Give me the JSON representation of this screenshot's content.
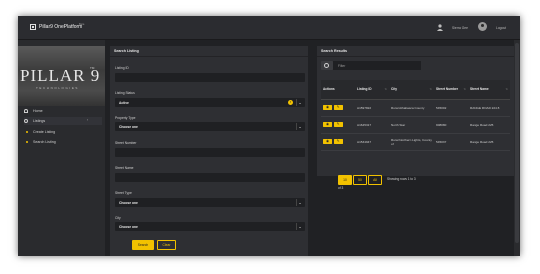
{
  "app": {
    "title": "Pillar9 OnePlatform",
    "badge": "Beta"
  },
  "user": {
    "name": "Sierra Gee",
    "logout": "Logout"
  },
  "brand": {
    "main": "PILLAR 9",
    "tm": "TM",
    "sub": "TECHNOLOGIES"
  },
  "sidebar": {
    "items": [
      {
        "label": "Home",
        "icon": "home-icon"
      },
      {
        "label": "Listings",
        "icon": "listings-icon",
        "chevron": "‹"
      },
      {
        "label": "Create Listing"
      },
      {
        "label": "Search Listing"
      }
    ]
  },
  "search": {
    "title": "Search Listing",
    "fields": [
      {
        "label": "Listing ID",
        "value": ""
      },
      {
        "label": "Listing Status",
        "value": "Active"
      },
      {
        "label": "Property Type",
        "value": "Choose one"
      },
      {
        "label": "Street Number",
        "value": ""
      },
      {
        "label": "Street Name",
        "value": ""
      },
      {
        "label": "Street Type",
        "value": "Choose one"
      },
      {
        "label": "City",
        "value": "Choose one"
      }
    ],
    "search_btn": "Search",
    "clear_btn": "Clear"
  },
  "results": {
    "title": "Search Results",
    "filter_placeholder": "Filter",
    "columns": [
      "Actions",
      "Listing ID",
      "City",
      "Street Number",
      "Street Name"
    ],
    "rows": [
      {
        "listing_id": "A1597822",
        "city": "Rural Athabasca County",
        "street_number": "545002",
        "street_name": "RANGE ROAD 224 8"
      },
      {
        "listing_id": "A1645317",
        "city": "North Star",
        "street_number": "908080",
        "street_name": "Range Road 225"
      },
      {
        "listing_id": "A1534947",
        "city": "Rural Northern Lights, County of",
        "street_number": "545037",
        "street_name": "Range Road 225"
      }
    ],
    "page_sizes": [
      "10",
      "50",
      "All"
    ],
    "showing": "Showing rows 1 to 3",
    "showing_tail": "of 3"
  },
  "colors": {
    "accent": "#f2c200",
    "background": "#202124",
    "panel": "#2e2f33"
  }
}
